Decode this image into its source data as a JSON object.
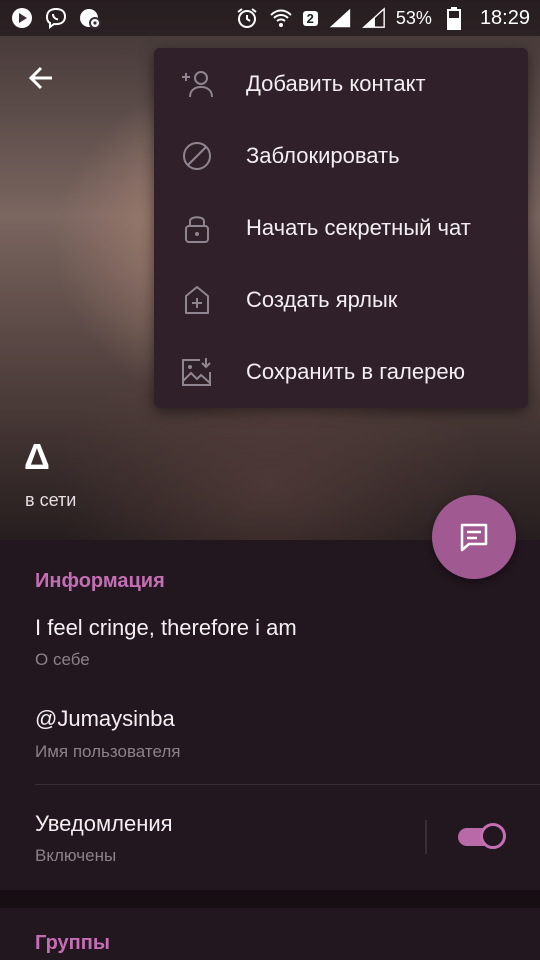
{
  "status_bar": {
    "sim_label": "2",
    "battery": "53%",
    "time": "18:29"
  },
  "profile": {
    "name": "Δ",
    "status": "в сети"
  },
  "menu": {
    "items": [
      {
        "label": "Добавить контакт",
        "icon": "add-contact-icon"
      },
      {
        "label": "Заблокировать",
        "icon": "block-icon"
      },
      {
        "label": "Начать секретный чат",
        "icon": "lock-icon"
      },
      {
        "label": "Создать ярлык",
        "icon": "add-shortcut-icon"
      },
      {
        "label": "Сохранить в галерею",
        "icon": "save-to-gallery-icon"
      }
    ]
  },
  "info": {
    "section_title": "Информация",
    "bio_value": "I feel cringe, therefore i am",
    "bio_caption": "О себе",
    "username_value": "@Jumaysinba",
    "username_caption": "Имя пользователя",
    "notifications_value": "Уведомления",
    "notifications_caption": "Включены",
    "notifications_enabled": true
  },
  "groups": {
    "section_title": "Группы"
  },
  "colors": {
    "accent": "#c46fb4",
    "fab": "#a15a91",
    "background": "#22161f",
    "menu_background": "#2f2029"
  }
}
